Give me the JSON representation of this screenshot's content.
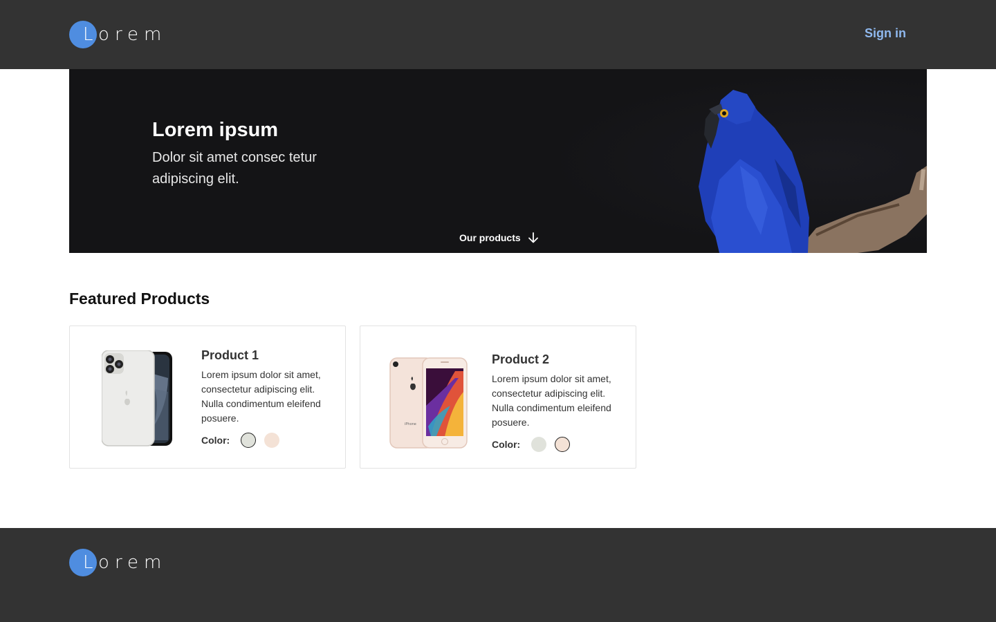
{
  "header": {
    "logo_letter": "L",
    "logo_text": "orem",
    "signin_label": "Sign in"
  },
  "hero": {
    "title": "Lorem ipsum",
    "subtitle": "Dolor sit amet consec tetur adipiscing elit.",
    "cta_label": "Our products"
  },
  "featured": {
    "title": "Featured Products",
    "products": [
      {
        "name": "Product 1",
        "description": "Lorem ipsum dolor sit amet, consectetur adipiscing elit. Nulla condimentum eleifend posuere.",
        "color_label": "Color:",
        "colors": [
          "#e0e2db",
          "#f4e2d6"
        ],
        "selected_color": 0
      },
      {
        "name": "Product 2",
        "description": "Lorem ipsum dolor sit amet, consectetur adipiscing elit. Nulla condimentum eleifend posuere.",
        "color_label": "Color:",
        "colors": [
          "#e0e2db",
          "#f4e2d6"
        ],
        "selected_color": 1
      }
    ]
  },
  "footer": {
    "logo_letter": "L",
    "logo_text": "orem"
  },
  "colors": {
    "header_bg": "#333333",
    "accent": "#4f8de0",
    "signin": "#8fb8ee",
    "hero_bg": "#141416"
  }
}
